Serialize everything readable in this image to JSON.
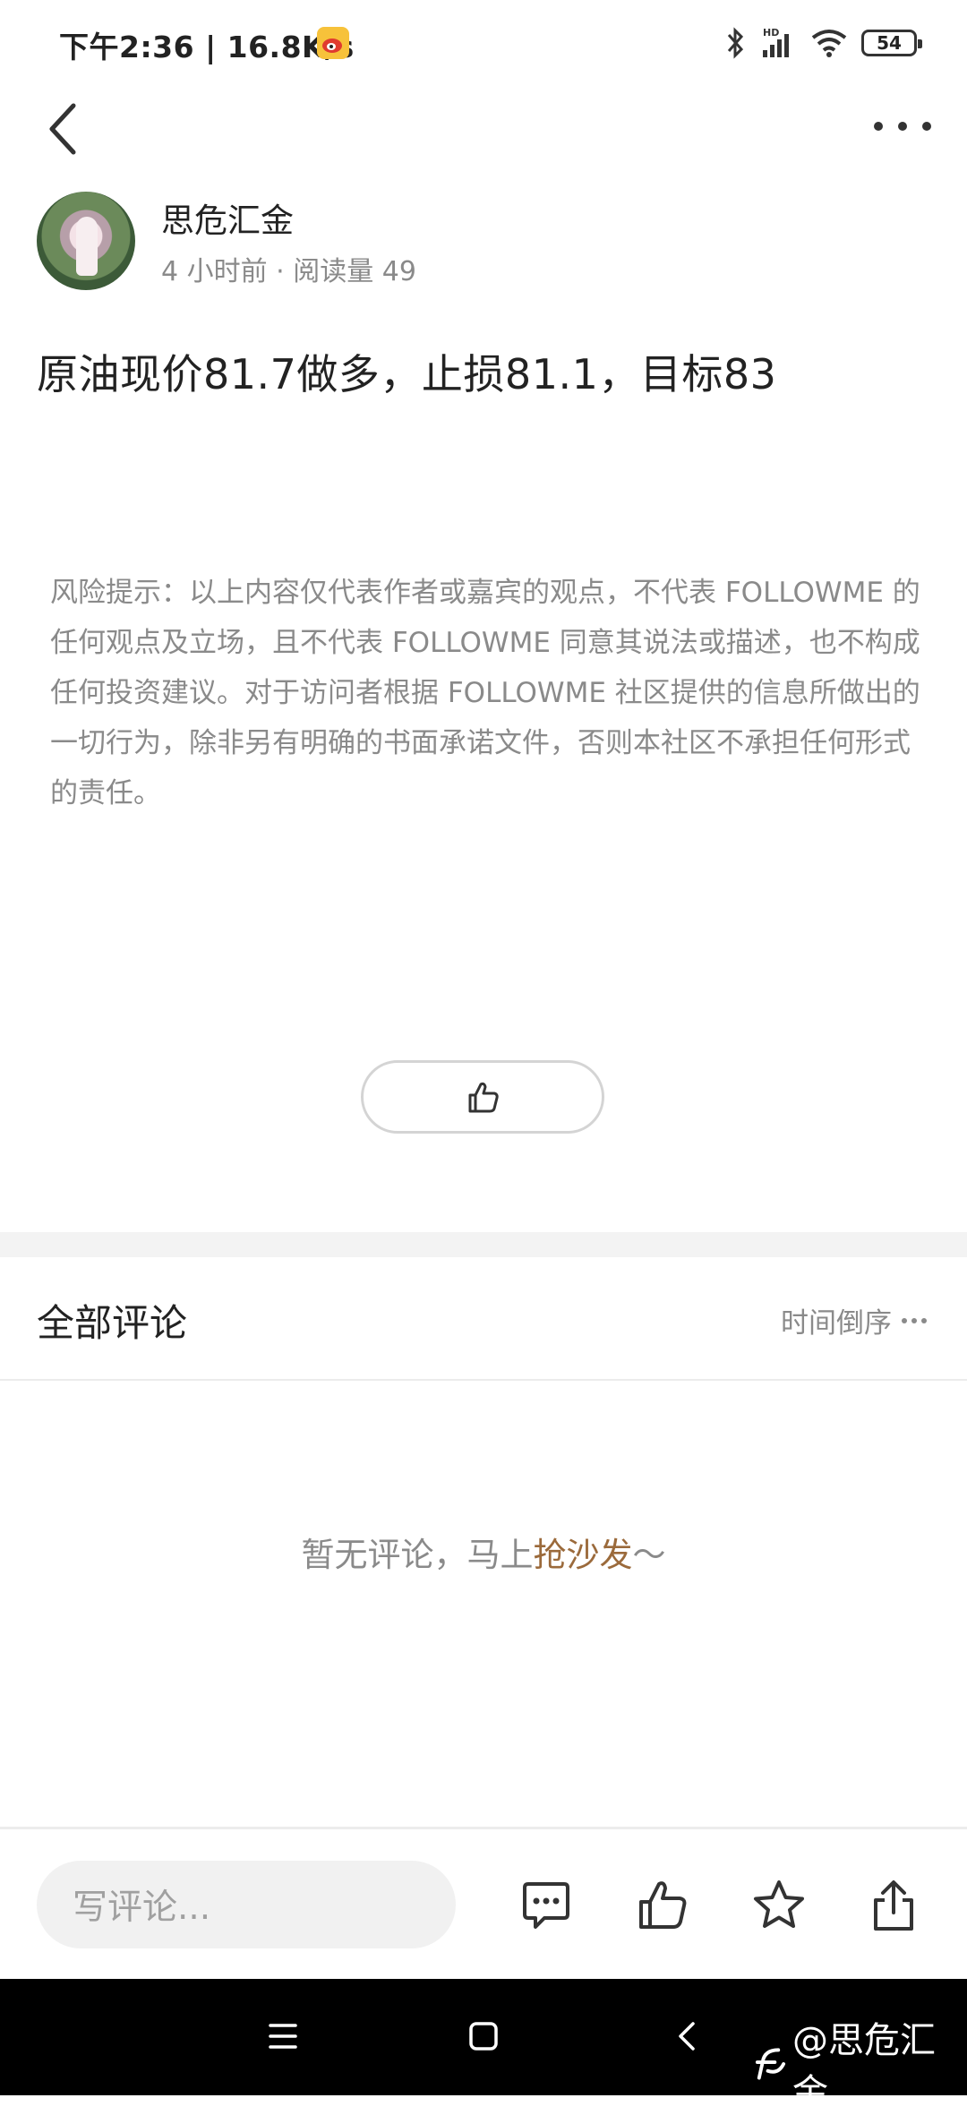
{
  "status_bar": {
    "time_speed": "下午2:36 | 16.8K/s",
    "battery": "54"
  },
  "author": {
    "name": "思危汇金",
    "meta": "4 小时前 · 阅读量 49"
  },
  "post": {
    "title": "原油现价81.7做多，止损81.1，目标83",
    "disclaimer": "风险提示：以上内容仅代表作者或嘉宾的观点，不代表 FOLLOWME 的任何观点及立场，且不代表 FOLLOWME 同意其说法或描述，也不构成任何投资建议。对于访问者根据 FOLLOWME 社区提供的信息所做出的一切行为，除非另有明确的书面承诺文件，否则本社区不承担任何形式的责任。"
  },
  "comments": {
    "title": "全部评论",
    "sort_label": "时间倒序",
    "empty_prefix": "暂无评论，马上",
    "empty_cta": "抢沙发",
    "empty_suffix": "～"
  },
  "bottom_bar": {
    "input_placeholder": "写评论..."
  },
  "watermark": {
    "text": "@思危汇金"
  },
  "icons": {
    "back": "back-arrow-icon",
    "more": "more-dots-icon",
    "like": "thumbs-up-icon",
    "comment": "comment-bubble-icon",
    "favorite": "star-icon",
    "share": "share-icon"
  },
  "colors": {
    "accent_cta": "#9b6a3b",
    "muted_text": "#8a8a8a",
    "system_nav_bg": "#000000"
  }
}
